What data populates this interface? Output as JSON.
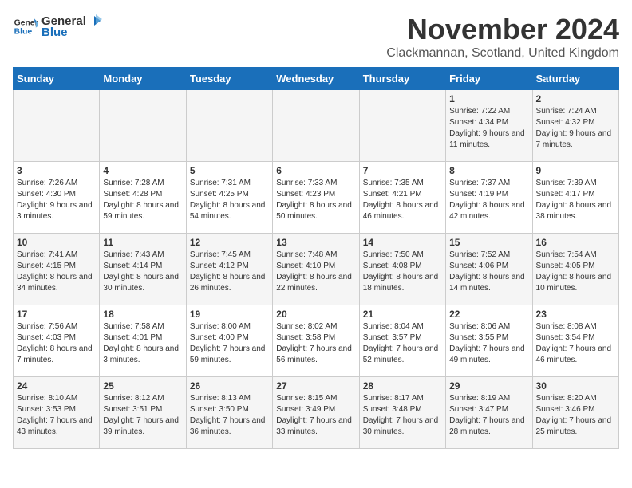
{
  "header": {
    "logo_general": "General",
    "logo_blue": "Blue",
    "month_title": "November 2024",
    "location": "Clackmannan, Scotland, United Kingdom"
  },
  "weekdays": [
    "Sunday",
    "Monday",
    "Tuesday",
    "Wednesday",
    "Thursday",
    "Friday",
    "Saturday"
  ],
  "weeks": [
    [
      {
        "day": "",
        "info": ""
      },
      {
        "day": "",
        "info": ""
      },
      {
        "day": "",
        "info": ""
      },
      {
        "day": "",
        "info": ""
      },
      {
        "day": "",
        "info": ""
      },
      {
        "day": "1",
        "info": "Sunrise: 7:22 AM\nSunset: 4:34 PM\nDaylight: 9 hours and 11 minutes."
      },
      {
        "day": "2",
        "info": "Sunrise: 7:24 AM\nSunset: 4:32 PM\nDaylight: 9 hours and 7 minutes."
      }
    ],
    [
      {
        "day": "3",
        "info": "Sunrise: 7:26 AM\nSunset: 4:30 PM\nDaylight: 9 hours and 3 minutes."
      },
      {
        "day": "4",
        "info": "Sunrise: 7:28 AM\nSunset: 4:28 PM\nDaylight: 8 hours and 59 minutes."
      },
      {
        "day": "5",
        "info": "Sunrise: 7:31 AM\nSunset: 4:25 PM\nDaylight: 8 hours and 54 minutes."
      },
      {
        "day": "6",
        "info": "Sunrise: 7:33 AM\nSunset: 4:23 PM\nDaylight: 8 hours and 50 minutes."
      },
      {
        "day": "7",
        "info": "Sunrise: 7:35 AM\nSunset: 4:21 PM\nDaylight: 8 hours and 46 minutes."
      },
      {
        "day": "8",
        "info": "Sunrise: 7:37 AM\nSunset: 4:19 PM\nDaylight: 8 hours and 42 minutes."
      },
      {
        "day": "9",
        "info": "Sunrise: 7:39 AM\nSunset: 4:17 PM\nDaylight: 8 hours and 38 minutes."
      }
    ],
    [
      {
        "day": "10",
        "info": "Sunrise: 7:41 AM\nSunset: 4:15 PM\nDaylight: 8 hours and 34 minutes."
      },
      {
        "day": "11",
        "info": "Sunrise: 7:43 AM\nSunset: 4:14 PM\nDaylight: 8 hours and 30 minutes."
      },
      {
        "day": "12",
        "info": "Sunrise: 7:45 AM\nSunset: 4:12 PM\nDaylight: 8 hours and 26 minutes."
      },
      {
        "day": "13",
        "info": "Sunrise: 7:48 AM\nSunset: 4:10 PM\nDaylight: 8 hours and 22 minutes."
      },
      {
        "day": "14",
        "info": "Sunrise: 7:50 AM\nSunset: 4:08 PM\nDaylight: 8 hours and 18 minutes."
      },
      {
        "day": "15",
        "info": "Sunrise: 7:52 AM\nSunset: 4:06 PM\nDaylight: 8 hours and 14 minutes."
      },
      {
        "day": "16",
        "info": "Sunrise: 7:54 AM\nSunset: 4:05 PM\nDaylight: 8 hours and 10 minutes."
      }
    ],
    [
      {
        "day": "17",
        "info": "Sunrise: 7:56 AM\nSunset: 4:03 PM\nDaylight: 8 hours and 7 minutes."
      },
      {
        "day": "18",
        "info": "Sunrise: 7:58 AM\nSunset: 4:01 PM\nDaylight: 8 hours and 3 minutes."
      },
      {
        "day": "19",
        "info": "Sunrise: 8:00 AM\nSunset: 4:00 PM\nDaylight: 7 hours and 59 minutes."
      },
      {
        "day": "20",
        "info": "Sunrise: 8:02 AM\nSunset: 3:58 PM\nDaylight: 7 hours and 56 minutes."
      },
      {
        "day": "21",
        "info": "Sunrise: 8:04 AM\nSunset: 3:57 PM\nDaylight: 7 hours and 52 minutes."
      },
      {
        "day": "22",
        "info": "Sunrise: 8:06 AM\nSunset: 3:55 PM\nDaylight: 7 hours and 49 minutes."
      },
      {
        "day": "23",
        "info": "Sunrise: 8:08 AM\nSunset: 3:54 PM\nDaylight: 7 hours and 46 minutes."
      }
    ],
    [
      {
        "day": "24",
        "info": "Sunrise: 8:10 AM\nSunset: 3:53 PM\nDaylight: 7 hours and 43 minutes."
      },
      {
        "day": "25",
        "info": "Sunrise: 8:12 AM\nSunset: 3:51 PM\nDaylight: 7 hours and 39 minutes."
      },
      {
        "day": "26",
        "info": "Sunrise: 8:13 AM\nSunset: 3:50 PM\nDaylight: 7 hours and 36 minutes."
      },
      {
        "day": "27",
        "info": "Sunrise: 8:15 AM\nSunset: 3:49 PM\nDaylight: 7 hours and 33 minutes."
      },
      {
        "day": "28",
        "info": "Sunrise: 8:17 AM\nSunset: 3:48 PM\nDaylight: 7 hours and 30 minutes."
      },
      {
        "day": "29",
        "info": "Sunrise: 8:19 AM\nSunset: 3:47 PM\nDaylight: 7 hours and 28 minutes."
      },
      {
        "day": "30",
        "info": "Sunrise: 8:20 AM\nSunset: 3:46 PM\nDaylight: 7 hours and 25 minutes."
      }
    ]
  ]
}
